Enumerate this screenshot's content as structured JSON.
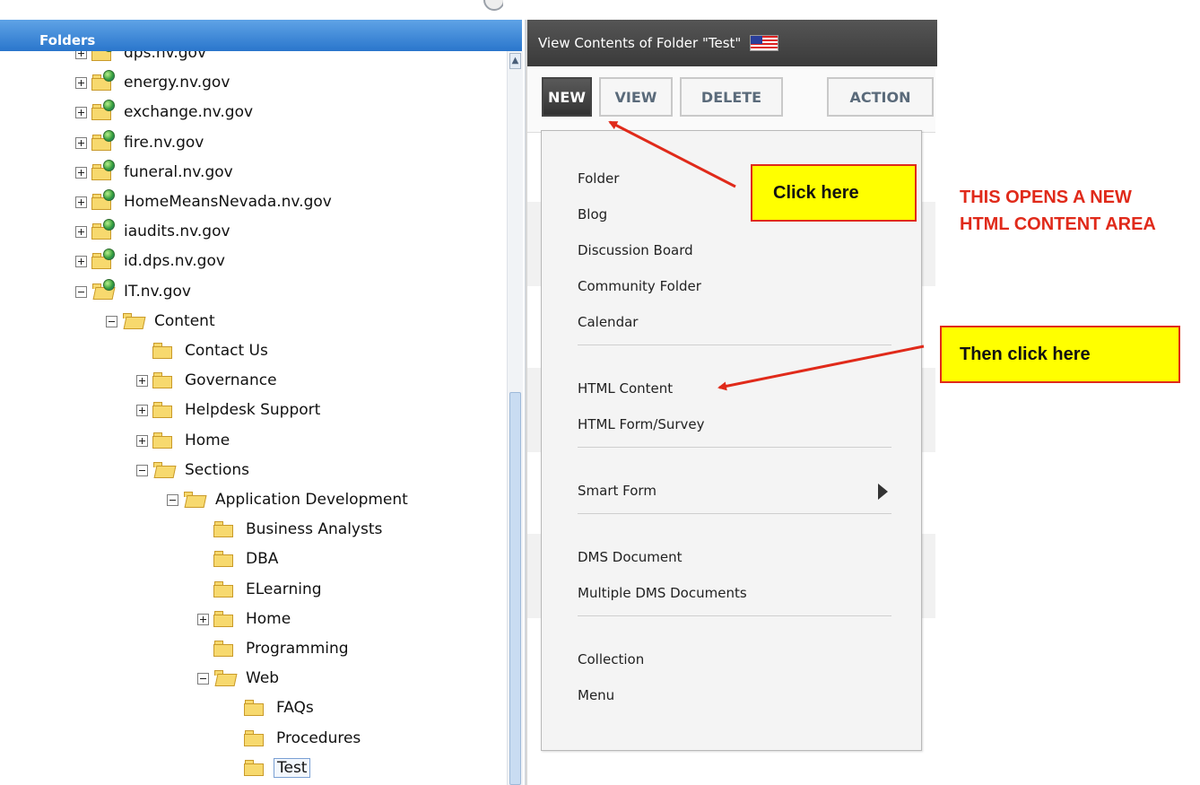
{
  "folders_panel": {
    "title": "Folders",
    "tree": [
      {
        "label": "dps.nv.gov",
        "expander": "plus",
        "icon": "site-folder-icon"
      },
      {
        "label": "energy.nv.gov",
        "expander": "plus",
        "icon": "site-folder-icon"
      },
      {
        "label": "exchange.nv.gov",
        "expander": "plus",
        "icon": "site-folder-icon"
      },
      {
        "label": "fire.nv.gov",
        "expander": "plus",
        "icon": "site-folder-icon"
      },
      {
        "label": "funeral.nv.gov",
        "expander": "plus",
        "icon": "site-folder-icon"
      },
      {
        "label": "HomeMeansNevada.nv.gov",
        "expander": "plus",
        "icon": "site-folder-icon"
      },
      {
        "label": "iaudits.nv.gov",
        "expander": "plus",
        "icon": "site-folder-icon"
      },
      {
        "label": "id.dps.nv.gov",
        "expander": "plus",
        "icon": "site-folder-icon"
      },
      {
        "label": "IT.nv.gov",
        "expander": "minus",
        "icon": "site-folder-open-icon"
      },
      {
        "label": "Content",
        "expander": "minus",
        "icon": "folder-open-icon"
      },
      {
        "label": "Contact Us",
        "expander": "none",
        "icon": "folder-icon"
      },
      {
        "label": "Governance",
        "expander": "plus",
        "icon": "folder-icon"
      },
      {
        "label": "Helpdesk Support",
        "expander": "plus",
        "icon": "folder-icon"
      },
      {
        "label": "Home",
        "expander": "plus",
        "icon": "folder-icon"
      },
      {
        "label": "Sections",
        "expander": "minus",
        "icon": "folder-open-icon"
      },
      {
        "label": "Application Development",
        "expander": "minus",
        "icon": "folder-open-icon"
      },
      {
        "label": "Business Analysts",
        "expander": "none",
        "icon": "folder-icon"
      },
      {
        "label": "DBA",
        "expander": "none",
        "icon": "folder-icon"
      },
      {
        "label": "ELearning",
        "expander": "none",
        "icon": "folder-icon"
      },
      {
        "label": "Home",
        "expander": "plus",
        "icon": "folder-icon"
      },
      {
        "label": "Programming",
        "expander": "none",
        "icon": "folder-icon"
      },
      {
        "label": "Web",
        "expander": "minus",
        "icon": "folder-open-icon"
      },
      {
        "label": "FAQs",
        "expander": "none",
        "icon": "folder-icon"
      },
      {
        "label": "Procedures",
        "expander": "none",
        "icon": "folder-icon"
      },
      {
        "label": "Test",
        "expander": "none",
        "icon": "folder-icon",
        "selected": true
      }
    ]
  },
  "view_panel": {
    "title": "View Contents of Folder \"Test\"",
    "language_flag": "us-flag-icon",
    "toolbar": {
      "new_label": "NEW",
      "view_label": "VIEW",
      "delete_label": "DELETE",
      "action_label": "ACTION"
    },
    "new_menu": {
      "groups": [
        [
          "Folder",
          "Blog",
          "Discussion Board",
          "Community Folder",
          "Calendar"
        ],
        [
          "HTML Content",
          "HTML Form/Survey"
        ],
        [
          "Smart Form"
        ],
        [
          "DMS Document",
          "Multiple DMS Documents"
        ],
        [
          "Collection",
          "Menu"
        ]
      ],
      "submenu_item": "Smart Form"
    }
  },
  "annotations": {
    "callout_1": "Click here",
    "callout_2": "Then click here",
    "note_line_1": "THIS OPENS A NEW",
    "note_line_2": "HTML CONTENT AREA",
    "callout_fill": "#ffff00",
    "accent_red": "#e02a1a"
  }
}
